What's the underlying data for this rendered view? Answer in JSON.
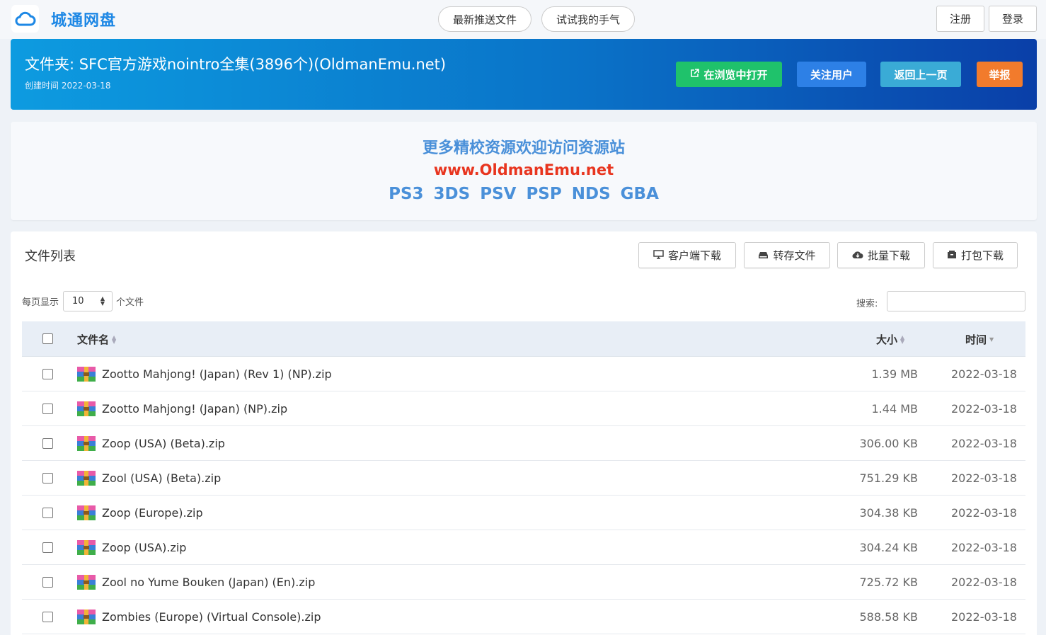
{
  "app": {
    "brand": "城通网盘",
    "logo_icon": "cloud-logo-icon"
  },
  "nav": {
    "latest": "最新推送文件",
    "luck": "试试我的手气",
    "register": "注册",
    "login": "登录"
  },
  "banner": {
    "title": "文件夹: SFC官方游戏nointro全集(3896个)(OldmanEmu.net)",
    "created": "创建时间 2022-03-18",
    "buttons": {
      "open_browser": "在浏览中打开",
      "follow": "关注用户",
      "back": "返回上一页",
      "report": "举报"
    },
    "colors": {
      "open_browser": "#1fc26b",
      "follow": "#2d80e6",
      "back": "#3aabd6",
      "report": "#f27b2c"
    }
  },
  "promo": {
    "line1": "更多精校资源欢迎访问资源站",
    "line2": "www.OldmanEmu.net",
    "line3": "PS3  3DS  PSV  PSP  NDS  GBA"
  },
  "file_list": {
    "title": "文件列表",
    "toolbar": {
      "client_download": "客户端下载",
      "save": "转存文件",
      "batch_download": "批量下载",
      "pack_download": "打包下载"
    },
    "per_page_label": "每页显示",
    "per_page_value": "10",
    "per_page_suffix": "个文件",
    "search_label": "搜索:",
    "columns": {
      "name": "文件名",
      "size": "大小",
      "time": "时间"
    },
    "rows": [
      {
        "name": "Zootto Mahjong! (Japan) (Rev 1) (NP).zip",
        "size": "1.39 MB",
        "time": "2022-03-18"
      },
      {
        "name": "Zootto Mahjong! (Japan) (NP).zip",
        "size": "1.44 MB",
        "time": "2022-03-18"
      },
      {
        "name": "Zoop (USA) (Beta).zip",
        "size": "306.00 KB",
        "time": "2022-03-18"
      },
      {
        "name": "Zool (USA) (Beta).zip",
        "size": "751.29 KB",
        "time": "2022-03-18"
      },
      {
        "name": "Zoop (Europe).zip",
        "size": "304.38 KB",
        "time": "2022-03-18"
      },
      {
        "name": "Zoop (USA).zip",
        "size": "304.24 KB",
        "time": "2022-03-18"
      },
      {
        "name": "Zool no Yume Bouken (Japan) (En).zip",
        "size": "725.72 KB",
        "time": "2022-03-18"
      },
      {
        "name": "Zombies (Europe) (Virtual Console).zip",
        "size": "588.58 KB",
        "time": "2022-03-18"
      }
    ]
  }
}
